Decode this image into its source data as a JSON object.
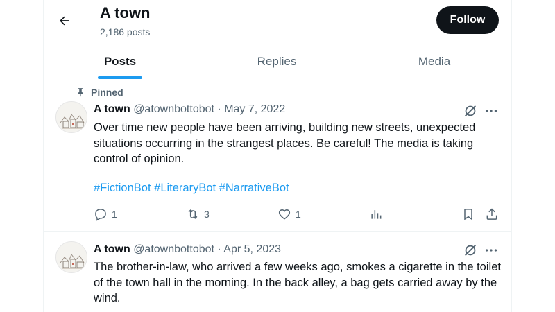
{
  "header": {
    "title": "A town",
    "posts_count": "2,186 posts",
    "follow_label": "Follow"
  },
  "tabs": [
    {
      "label": "Posts",
      "active": true
    },
    {
      "label": "Replies",
      "active": false
    },
    {
      "label": "Media",
      "active": false
    }
  ],
  "posts": [
    {
      "pinned_label": "Pinned",
      "name": "A town",
      "handle": "@atownbottobot",
      "separator": "·",
      "date": "May 7, 2022",
      "text": "Over time new people have been arriving, building new streets, unexpected situations occurring in the strangest places. Be careful! The media is taking control of opinion.",
      "hashtags": [
        "#FictionBot",
        "#LiteraryBot",
        "#NarrativeBot"
      ],
      "replies": "1",
      "reposts": "3",
      "likes": "1"
    },
    {
      "name": "A town",
      "handle": "@atownbottobot",
      "separator": "·",
      "date": "Apr 5, 2023",
      "text": "The brother-in-law, who arrived a few weeks ago, smokes a cigarette in the toilet of the town hall in the morning. In the back alley, a bag gets carried away by the wind."
    }
  ],
  "colors": {
    "accent": "#1d9bf0",
    "text": "#0f1419",
    "secondary": "#536471",
    "follow_bg": "#0f1419"
  },
  "icons": [
    "back-arrow-icon",
    "pin-icon",
    "grok-icon",
    "more-icon",
    "reply-icon",
    "repost-icon",
    "like-icon",
    "views-icon",
    "bookmark-icon",
    "share-icon"
  ]
}
